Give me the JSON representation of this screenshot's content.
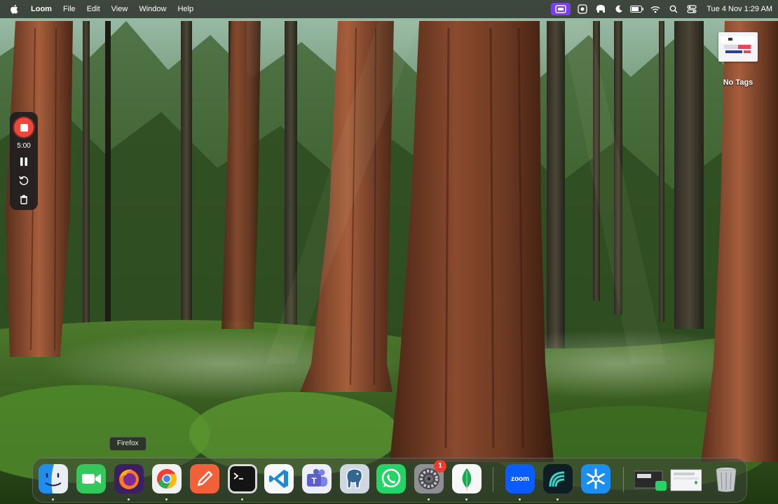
{
  "menubar": {
    "app_name": "Loom",
    "menus": [
      "File",
      "Edit",
      "View",
      "Window",
      "Help"
    ],
    "clock": "Tue 4 Nov  1:29 AM"
  },
  "desktop": {
    "file_label": "No Tags"
  },
  "loom_recorder": {
    "timer": "5:00"
  },
  "dock": {
    "tooltip": "Firefox",
    "apps": [
      {
        "name": "Finder",
        "icon": "finder-icon",
        "running": true
      },
      {
        "name": "FaceTime",
        "icon": "facetime-icon",
        "running": false
      },
      {
        "name": "Firefox",
        "icon": "firefox-icon",
        "running": true
      },
      {
        "name": "Google Chrome",
        "icon": "chrome-icon",
        "running": true
      },
      {
        "name": "Pencil",
        "icon": "pencil-app-icon",
        "running": false
      },
      {
        "name": "Terminal",
        "icon": "terminal-icon",
        "running": true
      },
      {
        "name": "Visual Studio Code",
        "icon": "vscode-icon",
        "running": false
      },
      {
        "name": "Microsoft Teams",
        "icon": "teams-icon",
        "running": false
      },
      {
        "name": "pgAdmin",
        "icon": "postgres-elephant-icon",
        "running": false
      },
      {
        "name": "WhatsApp",
        "icon": "whatsapp-icon",
        "running": false
      },
      {
        "name": "System Settings",
        "icon": "settings-gear-icon",
        "running": true,
        "badge": "1"
      },
      {
        "name": "MongoDB Compass",
        "icon": "mongodb-leaf-icon",
        "running": true
      },
      {
        "name": "Zoom",
        "icon": "zoom-icon",
        "running": true,
        "label": "zoom"
      },
      {
        "name": "Loom",
        "icon": "loom-icon",
        "running": true
      },
      {
        "name": "Snowflake",
        "icon": "snowflake-icon",
        "running": false
      }
    ],
    "colors": {
      "finder": "#1e8ff0",
      "facetime": "#34c759",
      "chrome_red": "#ea4335",
      "chrome_green": "#34a853",
      "chrome_yellow": "#fbbc05",
      "chrome_blue": "#4285f4",
      "vscode": "#1f8ad2",
      "teams": "#5b5fc7",
      "whatsapp": "#25d366",
      "zoom": "#0b5cff",
      "loom_recording": "#f0453a",
      "menubar_recording": "#7b3ff2"
    }
  }
}
